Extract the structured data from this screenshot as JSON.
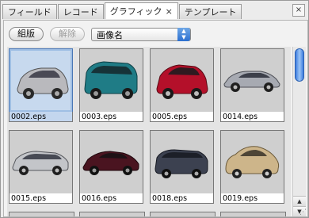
{
  "tabs": [
    {
      "label": "フィールド"
    },
    {
      "label": "レコード"
    },
    {
      "label": "グラフィック",
      "close": "×"
    },
    {
      "label": "テンプレート"
    }
  ],
  "close_symbol": "×",
  "toolbar": {
    "group_label": "組版",
    "release_label": "解除",
    "select_value": "画像名"
  },
  "items": [
    {
      "name": "0002.eps",
      "car": "silver hatchback"
    },
    {
      "name": "0003.eps",
      "car": "teal minivan"
    },
    {
      "name": "0005.eps",
      "car": "red hatchback"
    },
    {
      "name": "0014.eps",
      "car": "silver sedan"
    },
    {
      "name": "0015.eps",
      "car": "silver wagon"
    },
    {
      "name": "0016.eps",
      "car": "maroon sports car"
    },
    {
      "name": "0018.eps",
      "car": "dark gray wagon"
    },
    {
      "name": "0019.eps",
      "car": "beige beetle"
    }
  ],
  "colors": {
    "selected_bg": "#c7d9ee",
    "scroll_accent": "#3a7be0"
  }
}
